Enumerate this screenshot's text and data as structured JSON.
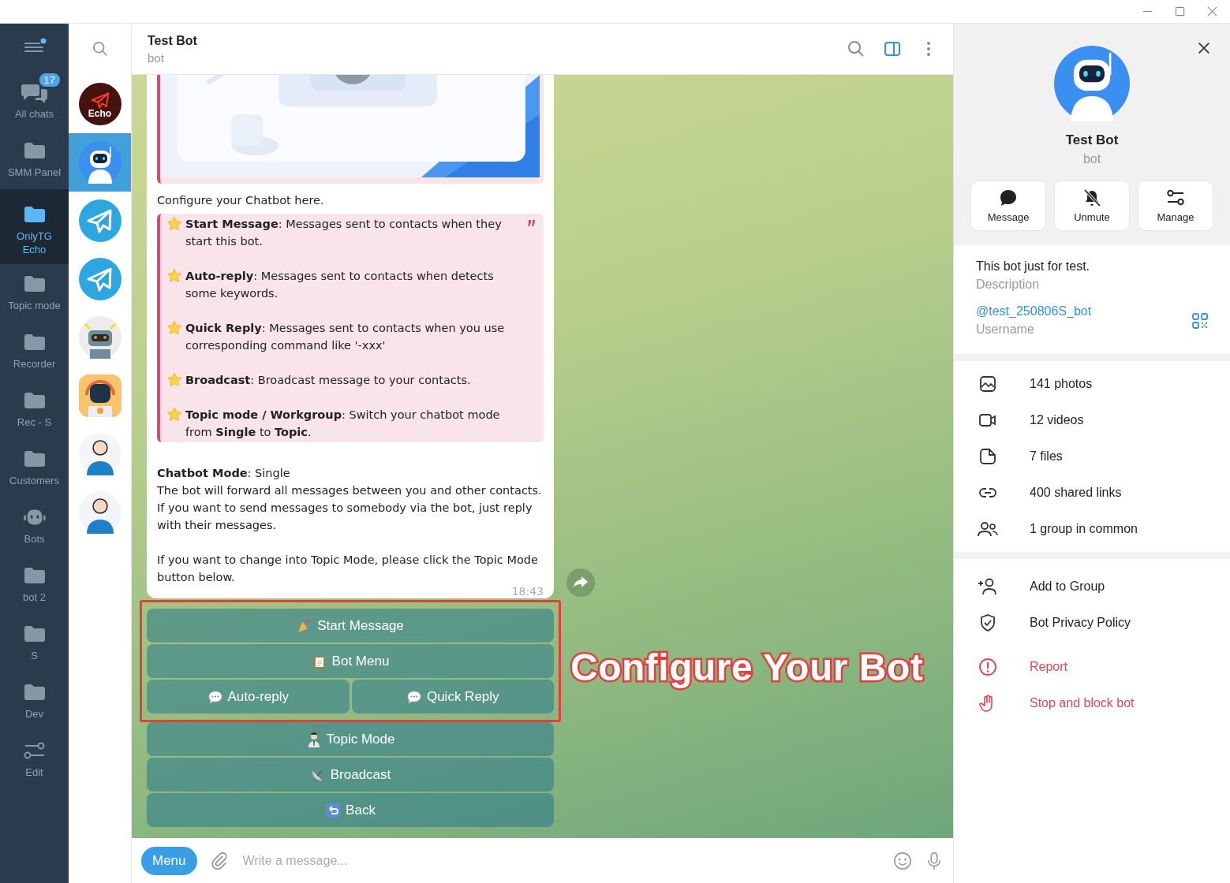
{
  "folders": [
    {
      "kind": "chats",
      "label": "All chats",
      "badge": "17",
      "selected": false
    },
    {
      "kind": "folder",
      "label": "SMM Panel",
      "selected": false
    },
    {
      "kind": "folder",
      "label": "OnlyTG Echo",
      "selected": true
    },
    {
      "kind": "folder",
      "label": "Topic mode",
      "selected": false
    },
    {
      "kind": "folder",
      "label": "Recorder",
      "selected": false
    },
    {
      "kind": "folder",
      "label": "Rec - S",
      "selected": false
    },
    {
      "kind": "folder",
      "label": "Customers",
      "selected": false
    },
    {
      "kind": "bot",
      "label": "Bots",
      "selected": false
    },
    {
      "kind": "folder",
      "label": "bot 2",
      "selected": false
    },
    {
      "kind": "folder",
      "label": "S",
      "selected": false
    },
    {
      "kind": "folder",
      "label": "Dev",
      "selected": false
    },
    {
      "kind": "edit",
      "label": "Edit",
      "selected": false
    }
  ],
  "chats": [
    {
      "kind": "echo",
      "avatar_text": "Echo",
      "selected": false
    },
    {
      "kind": "robot",
      "selected": true
    },
    {
      "kind": "plane",
      "selected": false
    },
    {
      "kind": "plane",
      "selected": false
    },
    {
      "kind": "robot_gray",
      "selected": false
    },
    {
      "kind": "robot_orange",
      "selected": false
    },
    {
      "kind": "person",
      "selected": false
    },
    {
      "kind": "person",
      "selected": false
    }
  ],
  "header": {
    "title": "Test Bot",
    "subtitle": "bot"
  },
  "message": {
    "caption": "Configure your Chatbot here.",
    "quote": [
      "**Start Message**: Messages sent to contacts when they start this bot.",
      "**Auto-reply**: Messages sent to contacts when detects some keywords.",
      "**Quick Reply**: Messages sent to contacts when you use corresponding command like '-xxx'",
      "**Broadcast**: Broadcast message to your contacts.",
      "**Topic mode / Workgroup**: Switch your chatbot mode from **Single** to **Topic**."
    ],
    "mode_line": "**Chatbot Mode**: Single",
    "paragraphs": [
      "The bot will forward all messages between you and other contacts. If you want to send messages to somebody via the bot, just reply with their messages.",
      "If you want to change into Topic Mode, please click the Topic Mode button below."
    ],
    "time": "18:43"
  },
  "keyboard": [
    {
      "highlighted": true,
      "buttons": [
        {
          "kind": "party",
          "label": "Start Message"
        }
      ]
    },
    {
      "highlighted": true,
      "buttons": [
        {
          "kind": "clipboard",
          "label": "Bot Menu"
        }
      ]
    },
    {
      "highlighted": true,
      "buttons": [
        {
          "kind": "speech",
          "label": "Auto-reply"
        },
        {
          "kind": "speech",
          "label": "Quick Reply"
        }
      ]
    },
    {
      "highlighted": false,
      "buttons": [
        {
          "kind": "person",
          "label": "Topic Mode"
        }
      ]
    },
    {
      "highlighted": false,
      "buttons": [
        {
          "kind": "dish",
          "label": "Broadcast"
        }
      ]
    },
    {
      "highlighted": false,
      "buttons": [
        {
          "kind": "back",
          "label": "Back"
        }
      ]
    }
  ],
  "annotation": "Configure Your Bot",
  "composer": {
    "menu": "Menu",
    "placeholder": "Write a message..."
  },
  "profile": {
    "name": "Test Bot",
    "subtitle": "bot",
    "actions": [
      {
        "kind": "message",
        "label": "Message"
      },
      {
        "kind": "unmute",
        "label": "Unmute"
      },
      {
        "kind": "manage",
        "label": "Manage"
      }
    ],
    "info": [
      {
        "kind": "text",
        "value": "This bot just for test.",
        "label": "Description"
      },
      {
        "kind": "link",
        "value": "@test_250806S_bot",
        "label": "Username"
      }
    ],
    "media": [
      {
        "label": "141 photos"
      },
      {
        "kind": "video",
        "label": "12 videos"
      },
      {
        "kind": "file",
        "label": "7 files"
      },
      {
        "kind": "link",
        "label": "400 shared links"
      },
      {
        "kind": "group",
        "label": "1 group in common"
      }
    ],
    "options": [
      {
        "kind": "add",
        "label": "Add to Group",
        "danger": false
      },
      {
        "kind": "shield",
        "label": "Bot Privacy Policy",
        "danger": false
      },
      {
        "kind": "report",
        "label": "Report",
        "danger": true
      },
      {
        "kind": "hand",
        "label": "Stop and block bot",
        "danger": true
      }
    ]
  }
}
